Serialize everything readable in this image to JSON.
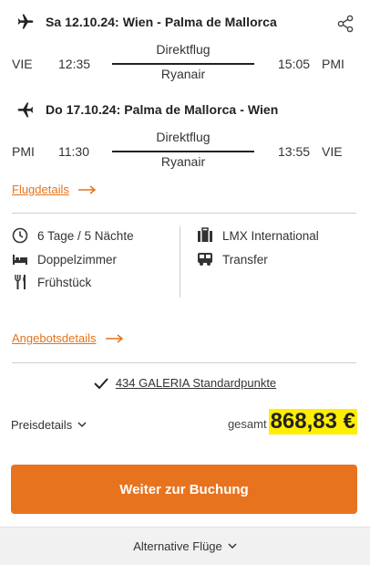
{
  "outbound": {
    "title": "Sa 12.10.24: Wien - Palma de Mallorca",
    "from_code": "VIE",
    "dep_time": "12:35",
    "type": "Direktflug",
    "airline": "Ryanair",
    "arr_time": "15:05",
    "to_code": "PMI"
  },
  "inbound": {
    "title": "Do 17.10.24: Palma de Mallorca - Wien",
    "from_code": "PMI",
    "dep_time": "11:30",
    "type": "Direktflug",
    "airline": "Ryanair",
    "arr_time": "13:55",
    "to_code": "VIE"
  },
  "flight_details_link": "Flugdetails",
  "features": {
    "duration": "6 Tage / 5 Nächte",
    "room": "Doppelzimmer",
    "board": "Frühstück",
    "operator": "LMX International",
    "transfer": "Transfer"
  },
  "offer_details_link": "Angebotsdetails",
  "points": "434 GALERIA Standardpunkte",
  "price": {
    "details_label": "Preisdetails",
    "total_label": "gesamt",
    "amount": "868,83 €"
  },
  "cta_label": "Weiter zur Buchung",
  "alt_flights_label": "Alternative Flüge",
  "colors": {
    "accent": "#e8731f",
    "link": "#e5731b",
    "price_highlight": "#ffee00"
  },
  "icons": [
    "plane-outbound-icon",
    "plane-inbound-icon",
    "share-icon",
    "arrow-right-icon",
    "clock-icon",
    "bed-icon",
    "cutlery-icon",
    "suitcase-icon",
    "bus-icon",
    "check-icon",
    "chevron-down-icon"
  ]
}
